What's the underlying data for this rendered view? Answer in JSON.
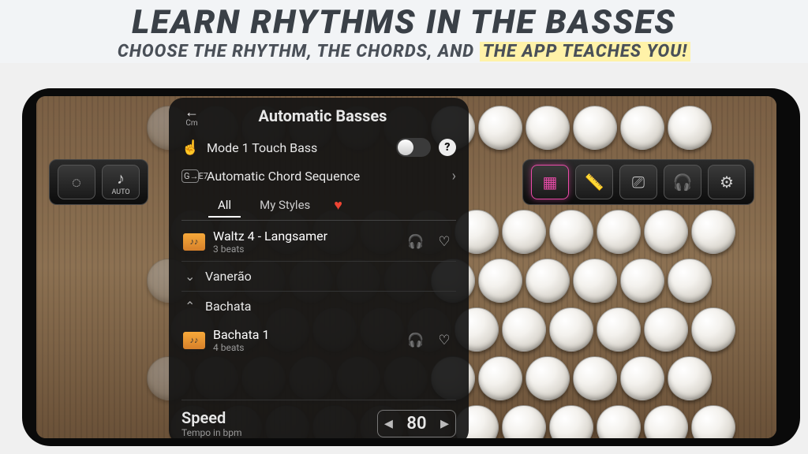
{
  "headline": {
    "title": "LEARN RHYTHMS IN THE BASSES",
    "subtitle_a": "CHOOSE THE RHYTHM, THE CHORDS, AND ",
    "subtitle_b": "THE APP TEACHES YOU!"
  },
  "toolbar_left": {
    "metronome_label": "",
    "auto_label": "AUTO"
  },
  "panel": {
    "back_label": "Cm",
    "title": "Automatic Basses",
    "mode_label": "Mode 1 Touch Bass",
    "chord_seq_label": "Automatic Chord Sequence",
    "tabs": {
      "all": "All",
      "mystyles": "My Styles"
    },
    "items": [
      {
        "title": "Waltz 4 - Langsamer",
        "sub": "3 beats"
      }
    ],
    "groups": [
      {
        "name": "Vanerão",
        "expanded": false
      },
      {
        "name": "Bachata",
        "expanded": true
      }
    ],
    "bachata_items": [
      {
        "title": "Bachata 1",
        "sub": "4 beats"
      }
    ],
    "speed": {
      "label": "Speed",
      "sub": "Tempo in bpm",
      "value": "80"
    }
  }
}
